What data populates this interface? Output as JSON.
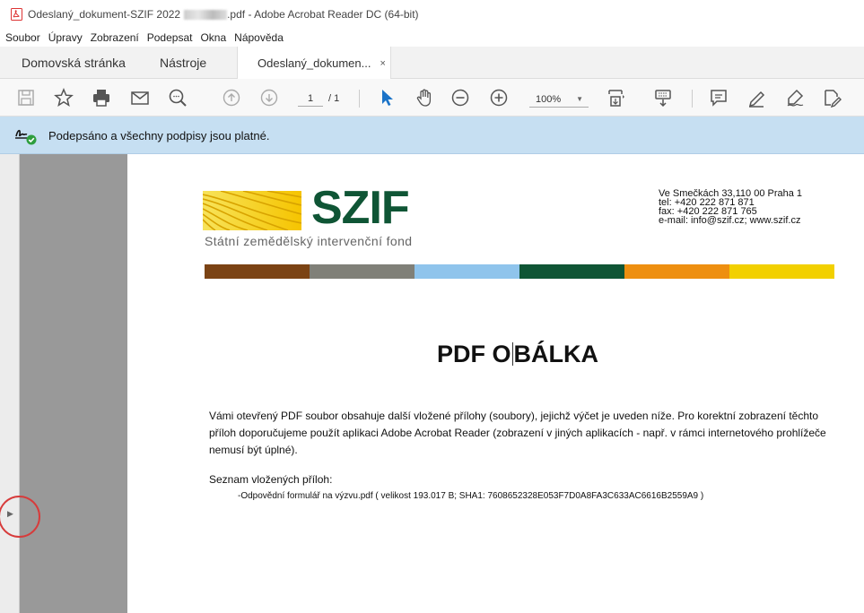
{
  "window": {
    "title_prefix": "Odeslaný_dokument-SZIF 2022",
    "title_suffix": ".pdf - Adobe Acrobat Reader DC (64-bit)"
  },
  "menu": [
    "Soubor",
    "Úpravy",
    "Zobrazení",
    "Podepsat",
    "Okna",
    "Nápověda"
  ],
  "tabs": {
    "home": "Domovská stránka",
    "tools": "Nástroje",
    "document": "Odeslaný_dokumen...",
    "close": "×"
  },
  "toolbar": {
    "page_current": "1",
    "page_total": "/ 1",
    "zoom": "100%"
  },
  "signature_bar": {
    "text": "Podepsáno a všechny podpisy jsou platné."
  },
  "document": {
    "logo_text": "SZIF",
    "logo_subtitle": "Státní zemědělský intervenční fond",
    "address_lines": [
      "Ve Smečkách 33,110 00 Praha 1",
      "tel: +420 222 871 871",
      "fax: +420 222 871 765",
      "e-mail: info@szif.cz; www.szif.cz"
    ],
    "color_bar": [
      "#7b4314",
      "#808078",
      "#8fc4ec",
      "#0f5535",
      "#ee8f10",
      "#f2d000"
    ],
    "title_a": "PDF O",
    "title_b": "BÁLKA",
    "paragraph": "Vámi otevřený PDF soubor obsahuje další vložené přílohy (soubory), jejichž výčet je uveden níže. Pro korektní zobrazení těchto příloh doporučujeme použít aplikaci Adobe Acrobat Reader (zobrazení v jiných aplikacích - např. v rámci internetového prohlížeče nemusí být úplné).",
    "list_heading": "Seznam vložených příloh:",
    "list_item": "-Odpovědní formulář na výzvu.pdf ( velikost   193.017  B; SHA1: 7608652328E053F7D0A8FA3C633AC6616B2559A9 )"
  },
  "colors": {
    "sig_bar_bg": "#c6dff2",
    "logo_green": "#0f5535",
    "highlight_circle": "#d73b3b"
  }
}
